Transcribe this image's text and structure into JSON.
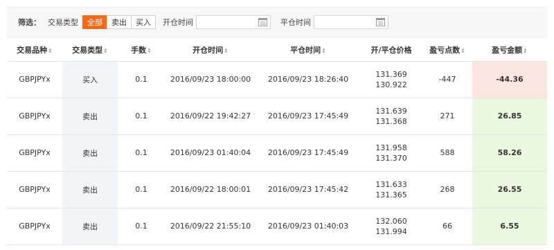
{
  "filter": {
    "label": "筛选：",
    "type_label": "交易类型",
    "buttons": [
      "全部",
      "卖出",
      "买入"
    ],
    "active_index": 0,
    "open_time_label": "开仓时间",
    "close_time_label": "平仓时间",
    "open_time_value": "",
    "close_time_value": ""
  },
  "table": {
    "headers": [
      "交易品种",
      "交易类型",
      "手数",
      "开仓时间",
      "平仓时间",
      "开/平仓价格",
      "盈亏点数",
      "盈亏金额"
    ],
    "sortable": [
      true,
      true,
      true,
      true,
      true,
      false,
      true,
      true
    ],
    "rows": [
      {
        "symbol": "GBPJPYx",
        "type": "买入",
        "lots": "0.1",
        "open_time": "2016/09/23 18:00:00",
        "close_time": "2016/09/23 18:26:40",
        "open_price": "131.369",
        "close_price": "130.922",
        "points": "-447",
        "amount": "-44.36",
        "status": "neg"
      },
      {
        "symbol": "GBPJPYx",
        "type": "卖出",
        "lots": "0.1",
        "open_time": "2016/09/22 19:42:27",
        "close_time": "2016/09/23 17:45:49",
        "open_price": "131.639",
        "close_price": "131.368",
        "points": "271",
        "amount": "26.85",
        "status": "pos"
      },
      {
        "symbol": "GBPJPYx",
        "type": "卖出",
        "lots": "0.1",
        "open_time": "2016/09/23 01:40:04",
        "close_time": "2016/09/23 17:45:49",
        "open_price": "131.958",
        "close_price": "131.370",
        "points": "588",
        "amount": "58.26",
        "status": "pos"
      },
      {
        "symbol": "GBPJPYx",
        "type": "卖出",
        "lots": "0.1",
        "open_time": "2016/09/22 18:00:01",
        "close_time": "2016/09/23 17:45:42",
        "open_price": "131.633",
        "close_price": "131.365",
        "points": "268",
        "amount": "26.55",
        "status": "pos"
      },
      {
        "symbol": "GBPJPYx",
        "type": "卖出",
        "lots": "0.1",
        "open_time": "2016/09/22 21:55:10",
        "close_time": "2016/09/23 01:40:03",
        "open_price": "132.060",
        "close_price": "131.994",
        "points": "66",
        "amount": "6.55",
        "status": "pos"
      }
    ]
  },
  "colors": {
    "accent": "#f66a1a",
    "loss_text": "#e0701f",
    "loss_bg": "#fde5e1",
    "profit_text": "#4d9a16",
    "profit_bg": "#e9f8de"
  }
}
